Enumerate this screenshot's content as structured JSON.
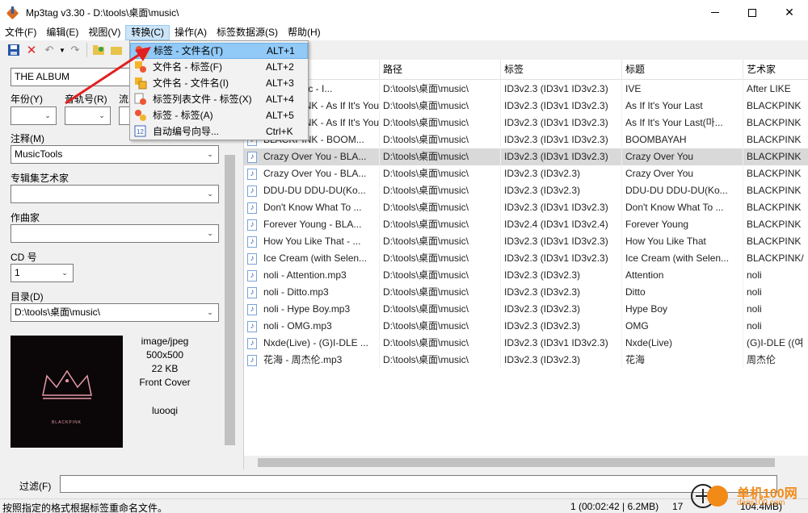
{
  "window": {
    "title": "Mp3tag v3.30  -  D:\\tools\\桌面\\music\\"
  },
  "menu": [
    {
      "label": "文件(F)"
    },
    {
      "label": "编辑(E)"
    },
    {
      "label": "视图(V)"
    },
    {
      "label": "转换(C)"
    },
    {
      "label": "操作(A)"
    },
    {
      "label": "标签数据源(S)"
    },
    {
      "label": "帮助(H)"
    }
  ],
  "dropdown": [
    {
      "label": "标签 - 文件名(T)",
      "shortcut": "ALT+1"
    },
    {
      "label": "文件名 - 标签(F)",
      "shortcut": "ALT+2"
    },
    {
      "label": "文件名 - 文件名(I)",
      "shortcut": "ALT+3"
    },
    {
      "label": "标签列表文件 - 标签(X)",
      "shortcut": "ALT+4"
    },
    {
      "label": "标签 - 标签(A)",
      "shortcut": "ALT+5"
    },
    {
      "label": "自动编号向导...",
      "shortcut": "Ctrl+K"
    }
  ],
  "leftpanel": {
    "album_value": "THE ALBUM",
    "year_label": "年份(Y)",
    "track_label": "音轨号(R)",
    "genre_label": "流",
    "comment_label": "注释(M)",
    "comment_value": "MusicTools",
    "album_artist_label": "专辑集艺术家",
    "composer_label": "作曲家",
    "cd_label": "CD 号",
    "cd_value": "1",
    "directory_label": "目录(D)",
    "directory_value": "D:\\tools\\桌面\\music\\",
    "image": {
      "mime": "image/jpeg",
      "size": "500x500",
      "filesize": "22 KB",
      "type": "Front Cover",
      "desc": "luooqi",
      "cover_text": "BLACKPINK"
    }
  },
  "list": {
    "columns": [
      "",
      "路径",
      "标签",
      "标题",
      "艺术家"
    ],
    "rows": [
      {
        "file": "IVE - music - I...",
        "path": "D:\\tools\\桌面\\music\\",
        "tag": "ID3v2.3 (ID3v1 ID3v2.3)",
        "title": "IVE",
        "artist": "After LIKE"
      },
      {
        "file": "BLACKPINK - As If It's Your Last - B...",
        "path": "D:\\tools\\桌面\\music\\",
        "tag": "ID3v2.3 (ID3v1 ID3v2.3)",
        "title": "As If It's Your Last",
        "artist": "BLACKPINK"
      },
      {
        "file": "BLACKPINK - As If It's Your Last(마...",
        "path": "D:\\tools\\桌面\\music\\",
        "tag": "ID3v2.3 (ID3v1 ID3v2.3)",
        "title": "As If It's Your Last(마...",
        "artist": "BLACKPINK"
      },
      {
        "file": "BLACKPINK - BOOM...",
        "path": "D:\\tools\\桌面\\music\\",
        "tag": "ID3v2.3 (ID3v1 ID3v2.3)",
        "title": "BOOMBAYAH",
        "artist": "BLACKPINK"
      },
      {
        "file": "Crazy Over You - BLA...",
        "path": "D:\\tools\\桌面\\music\\",
        "tag": "ID3v2.3 (ID3v1 ID3v2.3)",
        "title": "Crazy Over You",
        "artist": "BLACKPINK"
      },
      {
        "file": "Crazy Over You - BLA...",
        "path": "D:\\tools\\桌面\\music\\",
        "tag": "ID3v2.3 (ID3v2.3)",
        "title": "Crazy Over You",
        "artist": "BLACKPINK"
      },
      {
        "file": "DDU-DU DDU-DU(Ko...",
        "path": "D:\\tools\\桌面\\music\\",
        "tag": "ID3v2.3 (ID3v2.3)",
        "title": "DDU-DU DDU-DU(Ko...",
        "artist": "BLACKPINK"
      },
      {
        "file": "Don't Know What To ...",
        "path": "D:\\tools\\桌面\\music\\",
        "tag": "ID3v2.3 (ID3v1 ID3v2.3)",
        "title": "Don't Know What To ...",
        "artist": "BLACKPINK"
      },
      {
        "file": "Forever Young - BLA...",
        "path": "D:\\tools\\桌面\\music\\",
        "tag": "ID3v2.4 (ID3v1 ID3v2.4)",
        "title": "Forever Young",
        "artist": "BLACKPINK"
      },
      {
        "file": "How You Like That - ...",
        "path": "D:\\tools\\桌面\\music\\",
        "tag": "ID3v2.3 (ID3v1 ID3v2.3)",
        "title": "How You Like That",
        "artist": "BLACKPINK"
      },
      {
        "file": "Ice Cream (with Selen...",
        "path": "D:\\tools\\桌面\\music\\",
        "tag": "ID3v2.3 (ID3v1 ID3v2.3)",
        "title": "Ice Cream (with Selen...",
        "artist": "BLACKPINK/"
      },
      {
        "file": "noli - Attention.mp3",
        "path": "D:\\tools\\桌面\\music\\",
        "tag": "ID3v2.3 (ID3v2.3)",
        "title": "Attention",
        "artist": "noli"
      },
      {
        "file": "noli - Ditto.mp3",
        "path": "D:\\tools\\桌面\\music\\",
        "tag": "ID3v2.3 (ID3v2.3)",
        "title": "Ditto",
        "artist": "noli"
      },
      {
        "file": "noli - Hype Boy.mp3",
        "path": "D:\\tools\\桌面\\music\\",
        "tag": "ID3v2.3 (ID3v2.3)",
        "title": "Hype Boy",
        "artist": "noli"
      },
      {
        "file": "noli - OMG.mp3",
        "path": "D:\\tools\\桌面\\music\\",
        "tag": "ID3v2.3 (ID3v2.3)",
        "title": "OMG",
        "artist": "noli"
      },
      {
        "file": "Nxde(Live) - (G)I-DLE ...",
        "path": "D:\\tools\\桌面\\music\\",
        "tag": "ID3v2.3 (ID3v1 ID3v2.3)",
        "title": "Nxde(Live)",
        "artist": "(G)I-DLE ((여"
      },
      {
        "file": "花海 - 周杰伦.mp3",
        "path": "D:\\tools\\桌面\\music\\",
        "tag": "ID3v2.3 (ID3v2.3)",
        "title": "花海",
        "artist": "周杰伦"
      }
    ],
    "selected_row": 4
  },
  "filter": {
    "label": "过滤(F)",
    "value": ""
  },
  "status": {
    "hint": "按照指定的格式根据标签重命名文件。",
    "selected": "1 (00:02:42 | 6.2MB)",
    "total_count": "17",
    "total_size": "104.4MB)"
  },
  "watermark": {
    "text": "单机100网",
    "sub": "danji100.com"
  },
  "colors": {
    "selected_row": "#d9d9d9",
    "menu_highlight": "#91c9f7",
    "arrow": "#e02020"
  }
}
